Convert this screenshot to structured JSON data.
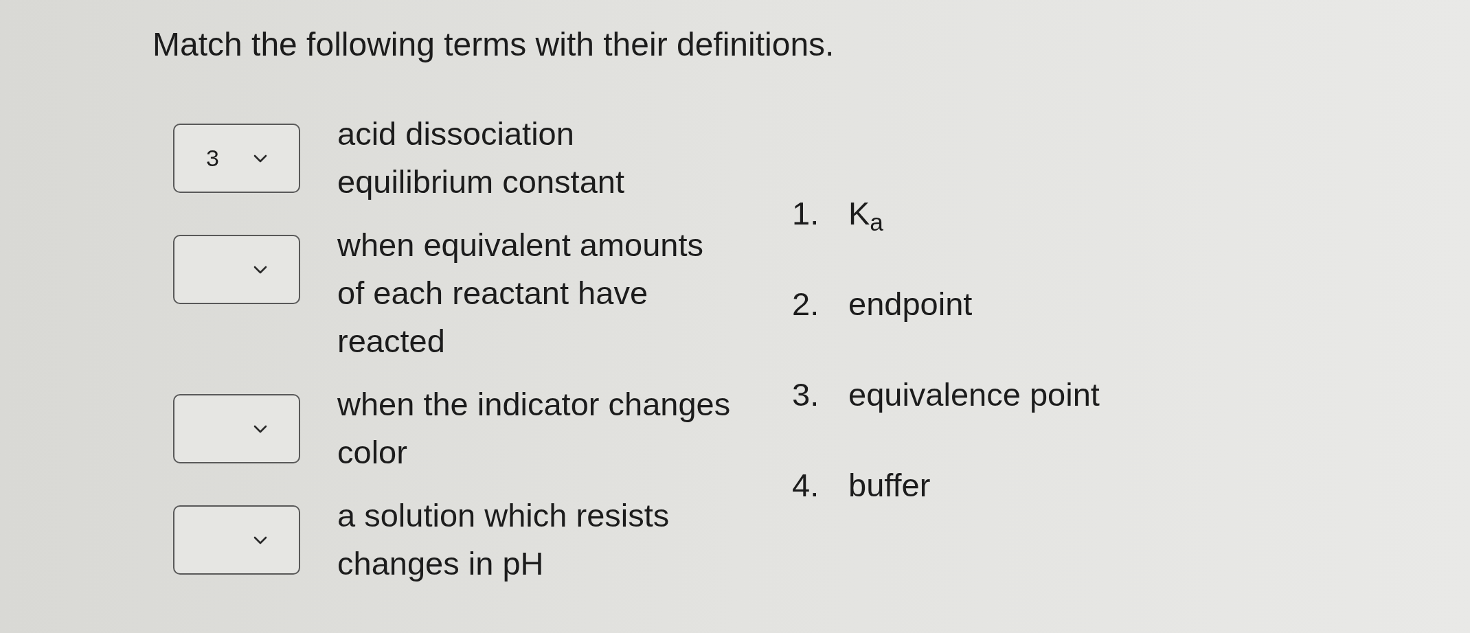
{
  "instruction": "Match the following terms with their definitions.",
  "definitions": [
    {
      "answer": "3",
      "text": "acid dissociation equilibrium constant"
    },
    {
      "text": "when equivalent amounts of each reactant have reacted"
    },
    {
      "text": "when the indicator changes color"
    },
    {
      "text": "a solution which resists changes in pH"
    }
  ],
  "terms": [
    {
      "number": "1.",
      "text": "K$_{a}$"
    },
    {
      "number": "2.",
      "text": "endpoint"
    },
    {
      "number": "3.",
      "text": "equivalence point"
    },
    {
      "number": "4.",
      "text": "buffer"
    }
  ]
}
